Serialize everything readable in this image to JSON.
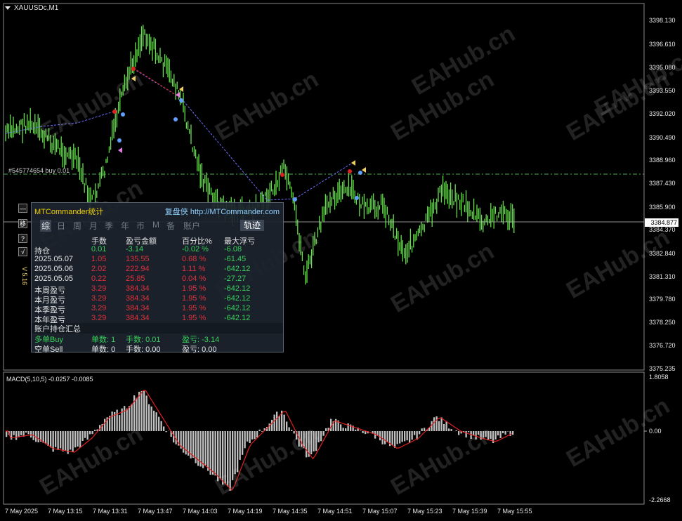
{
  "chart": {
    "symbol_title": "XAUUSDc,M1",
    "order_label": "#545774654 buy 0.01",
    "current_price": "3384.877",
    "price_labels": [
      "3398.130",
      "3396.610",
      "3395.080",
      "3393.550",
      "3392.020",
      "3390.490",
      "3388.960",
      "3387.430",
      "3385.900",
      "3384.370",
      "3382.840",
      "3381.310",
      "3379.780",
      "3378.250",
      "3376.720",
      "3375.235"
    ],
    "time_labels": [
      "7 May 2025",
      "7 May 13:15",
      "7 May 13:31",
      "7 May 13:47",
      "7 May 14:03",
      "7 May 14:19",
      "7 May 14:35",
      "7 May 14:51",
      "7 May 15:07",
      "7 May 15:23",
      "7 May 15:39",
      "7 May 15:55"
    ],
    "candle_color": "#66e04a",
    "watermark": "EAHub.cn"
  },
  "macd": {
    "title": "MACD(5,10,5) -0.0257 -0.0085",
    "scale_labels": [
      "1.8058",
      "0.00",
      "-2.2668"
    ],
    "histogram_color": "#c0c0c0",
    "signal_color": "#e02020"
  },
  "side_buttons": [
    "—",
    "移",
    "?",
    "√"
  ],
  "version": "V 5.16",
  "panel": {
    "title": "MTCommander统计",
    "link": "复盘侠 http://MTCommander.com",
    "tabs": [
      "综",
      "日",
      "周",
      "月",
      "季",
      "年",
      "币",
      "M",
      "备",
      "账户"
    ],
    "track_button": "轨迹",
    "headers": [
      "手数",
      "盈亏金额",
      "百分比%",
      "最大浮亏"
    ],
    "rows": [
      {
        "label": "持仓",
        "lots": "0.01",
        "pnl": "-3.14",
        "pct": "-0.02 %",
        "max": "-6.08",
        "color": "green"
      },
      {
        "label": "2025.05.07",
        "lots": "1.05",
        "pnl": "135.55",
        "pct": "0.68 %",
        "max": "-61.45",
        "color": "red"
      },
      {
        "label": "2025.05.06",
        "lots": "2.02",
        "pnl": "222.94",
        "pct": "1.11 %",
        "max": "-642.12",
        "color": "red"
      },
      {
        "label": "2025.05.05",
        "lots": "0.22",
        "pnl": "25.85",
        "pct": "0.04 %",
        "max": "-27.27",
        "color": "red"
      },
      {
        "label": "本周盈亏",
        "lots": "3.29",
        "pnl": "384.34",
        "pct": "1.95 %",
        "max": "-642.12",
        "color": "red"
      },
      {
        "label": "本月盈亏",
        "lots": "3.29",
        "pnl": "384.34",
        "pct": "1.95 %",
        "max": "-642.12",
        "color": "red"
      },
      {
        "label": "本季盈亏",
        "lots": "3.29",
        "pnl": "384.34",
        "pct": "1.95 %",
        "max": "-642.12",
        "color": "red"
      },
      {
        "label": "本年盈亏",
        "lots": "3.29",
        "pnl": "384.34",
        "pct": "1.95 %",
        "max": "-642.12",
        "color": "red"
      }
    ],
    "summary_title": "账户持仓汇总",
    "summary_rows": [
      {
        "label": "多单Buy",
        "count": "单数: 1",
        "lots": "手数: 0.01",
        "pnl": "盈亏: -3.14"
      },
      {
        "label": "空单Sell",
        "count": "单数: 0",
        "lots": "手数: 0.00",
        "pnl": "盈亏: 0.00"
      }
    ]
  }
}
